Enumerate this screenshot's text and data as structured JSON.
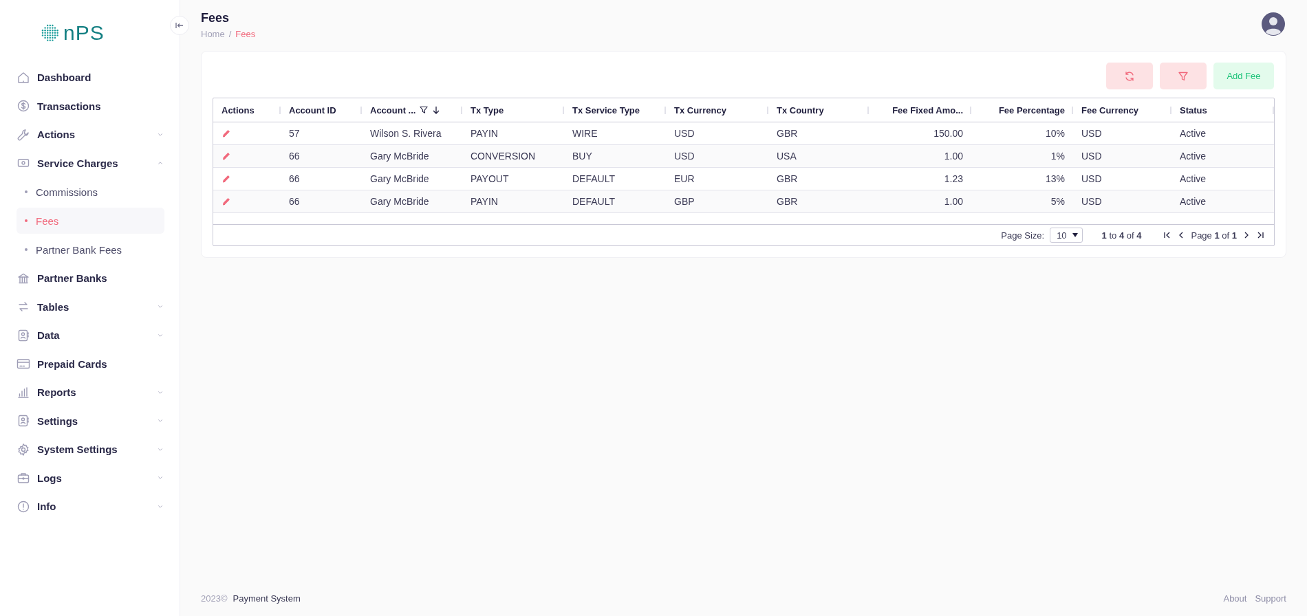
{
  "logo": {
    "text": "nPS"
  },
  "sidebar": {
    "items": [
      {
        "label": "Dashboard",
        "kind": "link"
      },
      {
        "label": "Transactions",
        "kind": "link"
      },
      {
        "label": "Actions",
        "kind": "group",
        "expanded": false
      },
      {
        "label": "Service Charges",
        "kind": "group",
        "expanded": true,
        "children": [
          {
            "label": "Commissions",
            "selected": false
          },
          {
            "label": "Fees",
            "selected": true
          },
          {
            "label": "Partner Bank Fees",
            "selected": false
          }
        ]
      },
      {
        "label": "Partner Banks",
        "kind": "link"
      },
      {
        "label": "Tables",
        "kind": "group",
        "expanded": false
      },
      {
        "label": "Data",
        "kind": "group",
        "expanded": false
      },
      {
        "label": "Prepaid Cards",
        "kind": "link"
      },
      {
        "label": "Reports",
        "kind": "group",
        "expanded": false
      },
      {
        "label": "Settings",
        "kind": "group",
        "expanded": false
      },
      {
        "label": "System Settings",
        "kind": "group",
        "expanded": false
      },
      {
        "label": "Logs",
        "kind": "group",
        "expanded": false
      },
      {
        "label": "Info",
        "kind": "group",
        "expanded": false
      }
    ]
  },
  "header": {
    "title": "Fees",
    "separator": "/",
    "breadcrumb": [
      {
        "label": "Home",
        "selected": false
      },
      {
        "label": "Fees",
        "selected": true
      }
    ]
  },
  "toolbar": {
    "add_button": "Add Fee"
  },
  "table": {
    "columns": [
      {
        "label": "Actions",
        "kind": "action",
        "filtered": false,
        "sorted": false
      },
      {
        "label": "Account ID",
        "kind": "text",
        "filtered": false,
        "sorted": false
      },
      {
        "label": "Account ...",
        "kind": "text",
        "filtered": true,
        "sorted": true
      },
      {
        "label": "Tx Type",
        "kind": "text",
        "filtered": false,
        "sorted": false
      },
      {
        "label": "Tx Service Type",
        "kind": "text",
        "filtered": false,
        "sorted": false
      },
      {
        "label": "Tx Currency",
        "kind": "text",
        "filtered": false,
        "sorted": false
      },
      {
        "label": "Tx Country",
        "kind": "text",
        "filtered": false,
        "sorted": false
      },
      {
        "label": "Fee Fixed Amo...",
        "kind": "number",
        "filtered": false,
        "sorted": false
      },
      {
        "label": "Fee Percentage",
        "kind": "number",
        "filtered": false,
        "sorted": false
      },
      {
        "label": "Fee Currency",
        "kind": "text",
        "filtered": false,
        "sorted": false
      },
      {
        "label": "Status",
        "kind": "text",
        "filtered": false,
        "sorted": false
      }
    ],
    "rows": [
      {
        "cells": [
          "",
          "57",
          "Wilson S. Rivera",
          "PAYIN",
          "WIRE",
          "USD",
          "GBR",
          "150.00",
          "10%",
          "USD",
          "Active"
        ]
      },
      {
        "cells": [
          "",
          "66",
          "Gary McBride",
          "CONVERSION",
          "BUY",
          "USD",
          "USA",
          "1.00",
          "1%",
          "USD",
          "Active"
        ]
      },
      {
        "cells": [
          "",
          "66",
          "Gary McBride",
          "PAYOUT",
          "DEFAULT",
          "EUR",
          "GBR",
          "1.23",
          "13%",
          "USD",
          "Active"
        ]
      },
      {
        "cells": [
          "",
          "66",
          "Gary McBride",
          "PAYIN",
          "DEFAULT",
          "GBP",
          "GBR",
          "1.00",
          "5%",
          "USD",
          "Active"
        ]
      }
    ],
    "pagination": {
      "page_size_label": "Page Size:",
      "page_size": "10",
      "range": "**1** to **4** of **4**",
      "page": "Page **1** of **1**"
    }
  },
  "footer": {
    "year": "2023©",
    "company": "Payment System",
    "links": [
      "About",
      "Support"
    ]
  }
}
